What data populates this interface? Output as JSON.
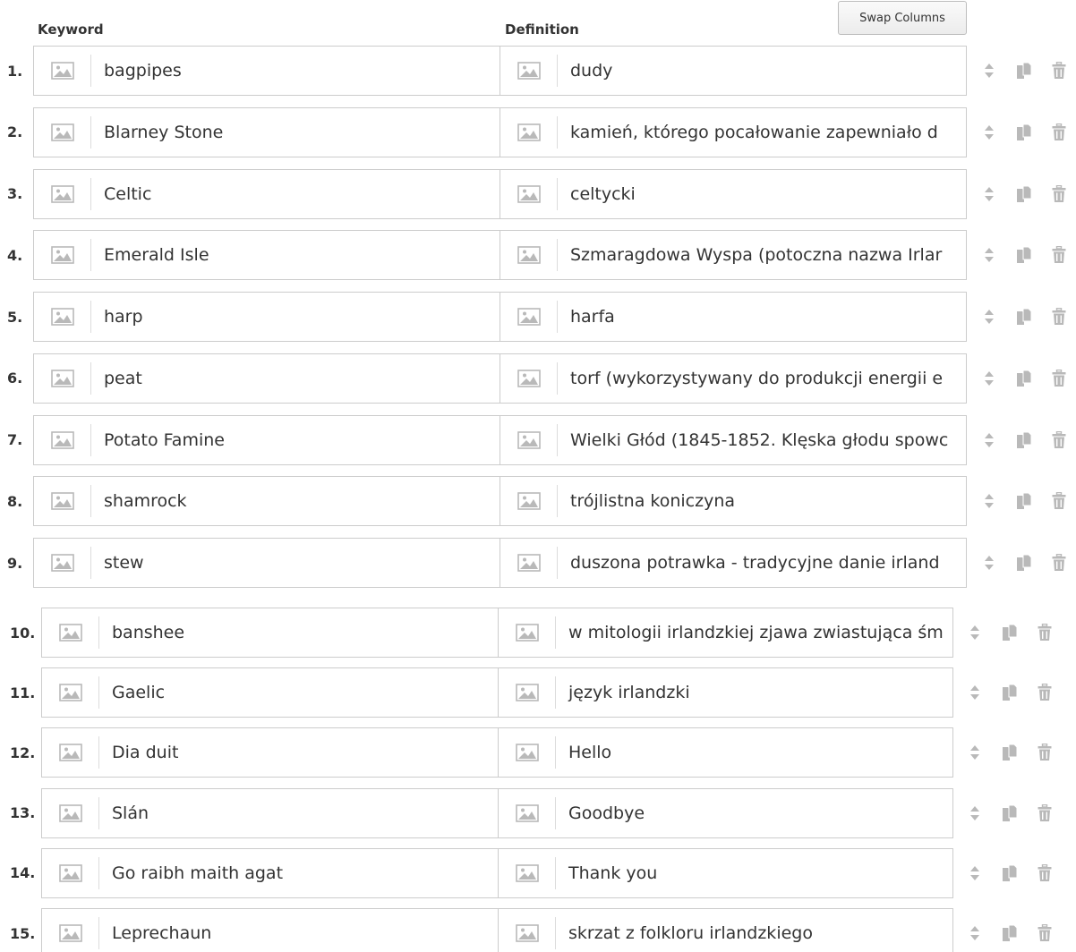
{
  "headers": {
    "keyword": "Keyword",
    "definition": "Definition"
  },
  "swap_label": "Swap Columns",
  "rows": [
    {
      "num": "1.",
      "keyword": "bagpipes",
      "definition": "dudy"
    },
    {
      "num": "2.",
      "keyword": "Blarney Stone",
      "definition": "kamień, którego pocałowanie zapewniało d"
    },
    {
      "num": "3.",
      "keyword": "Celtic",
      "definition": "celtycki"
    },
    {
      "num": "4.",
      "keyword": "Emerald Isle",
      "definition": "Szmaragdowa Wyspa (potoczna nazwa Irlar"
    },
    {
      "num": "5.",
      "keyword": "harp",
      "definition": "harfa"
    },
    {
      "num": "6.",
      "keyword": "peat",
      "definition": "torf (wykorzystywany do produkcji energii e"
    },
    {
      "num": "7.",
      "keyword": "Potato Famine",
      "definition": "Wielki Głód (1845-1852. Klęska głodu spowc"
    },
    {
      "num": "8.",
      "keyword": "shamrock",
      "definition": "trójlistna koniczyna"
    },
    {
      "num": "9.",
      "keyword": "stew",
      "definition": "duszona potrawka - tradycyjne danie irland"
    },
    {
      "num": "10.",
      "keyword": "banshee",
      "definition": "w mitologii irlandzkiej zjawa zwiastująca śm"
    },
    {
      "num": "11.",
      "keyword": "Gaelic",
      "definition": "język irlandzki"
    },
    {
      "num": "12.",
      "keyword": "Dia duit",
      "definition": "Hello"
    },
    {
      "num": "13.",
      "keyword": "Slán",
      "definition": "Goodbye"
    },
    {
      "num": "14.",
      "keyword": "Go raibh maith agat",
      "definition": "Thank you"
    },
    {
      "num": "15.",
      "keyword": "Leprechaun",
      "definition": "skrzat z folkloru irlandzkiego"
    }
  ],
  "icons": {
    "image": "image-icon",
    "sort": "sort-handle-icon",
    "copy": "copy-icon",
    "delete": "trash-icon"
  },
  "colors": {
    "icon": "#b9b9b9",
    "border": "#cccccc",
    "text": "#333333"
  }
}
